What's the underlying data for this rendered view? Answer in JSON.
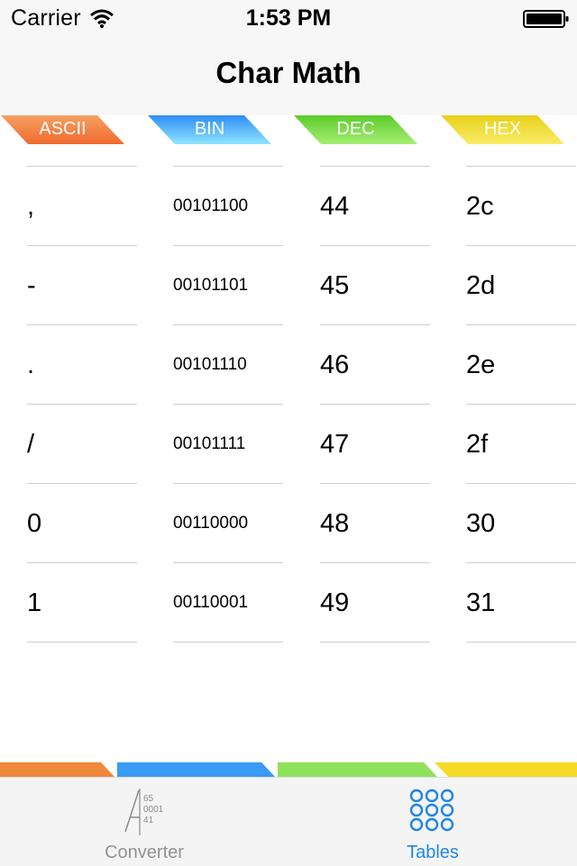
{
  "status_bar": {
    "carrier": "Carrier",
    "time": "1:53 PM"
  },
  "nav": {
    "title": "Char Math"
  },
  "columns": [
    {
      "label": "ASCII",
      "color": "#f5793a"
    },
    {
      "label": "BIN",
      "color": "#4aa8ff"
    },
    {
      "label": "DEC",
      "color": "#6cd43a"
    },
    {
      "label": "HEX",
      "color": "#f0d81e"
    }
  ],
  "rows": [
    {
      "ascii": ",",
      "bin": "00101100",
      "dec": "44",
      "hex": "2c"
    },
    {
      "ascii": "-",
      "bin": "00101101",
      "dec": "45",
      "hex": "2d"
    },
    {
      "ascii": ".",
      "bin": "00101110",
      "dec": "46",
      "hex": "2e"
    },
    {
      "ascii": "/",
      "bin": "00101111",
      "dec": "47",
      "hex": "2f"
    },
    {
      "ascii": "0",
      "bin": "00110000",
      "dec": "48",
      "hex": "30"
    },
    {
      "ascii": "1",
      "bin": "00110001",
      "dec": "49",
      "hex": "31"
    }
  ],
  "tab_bar": {
    "tabs": [
      {
        "label": "Converter",
        "icon": "converter-icon",
        "selected": false
      },
      {
        "label": "Tables",
        "icon": "grid-icon",
        "selected": true
      }
    ],
    "converter_icon_text": [
      "65",
      "0001",
      "41"
    ]
  },
  "colors": {
    "accent": "#1f86e5",
    "ascii": "#f5793a",
    "bin": "#4aa8ff",
    "dec": "#6cd43a",
    "hex": "#f0d81e"
  }
}
